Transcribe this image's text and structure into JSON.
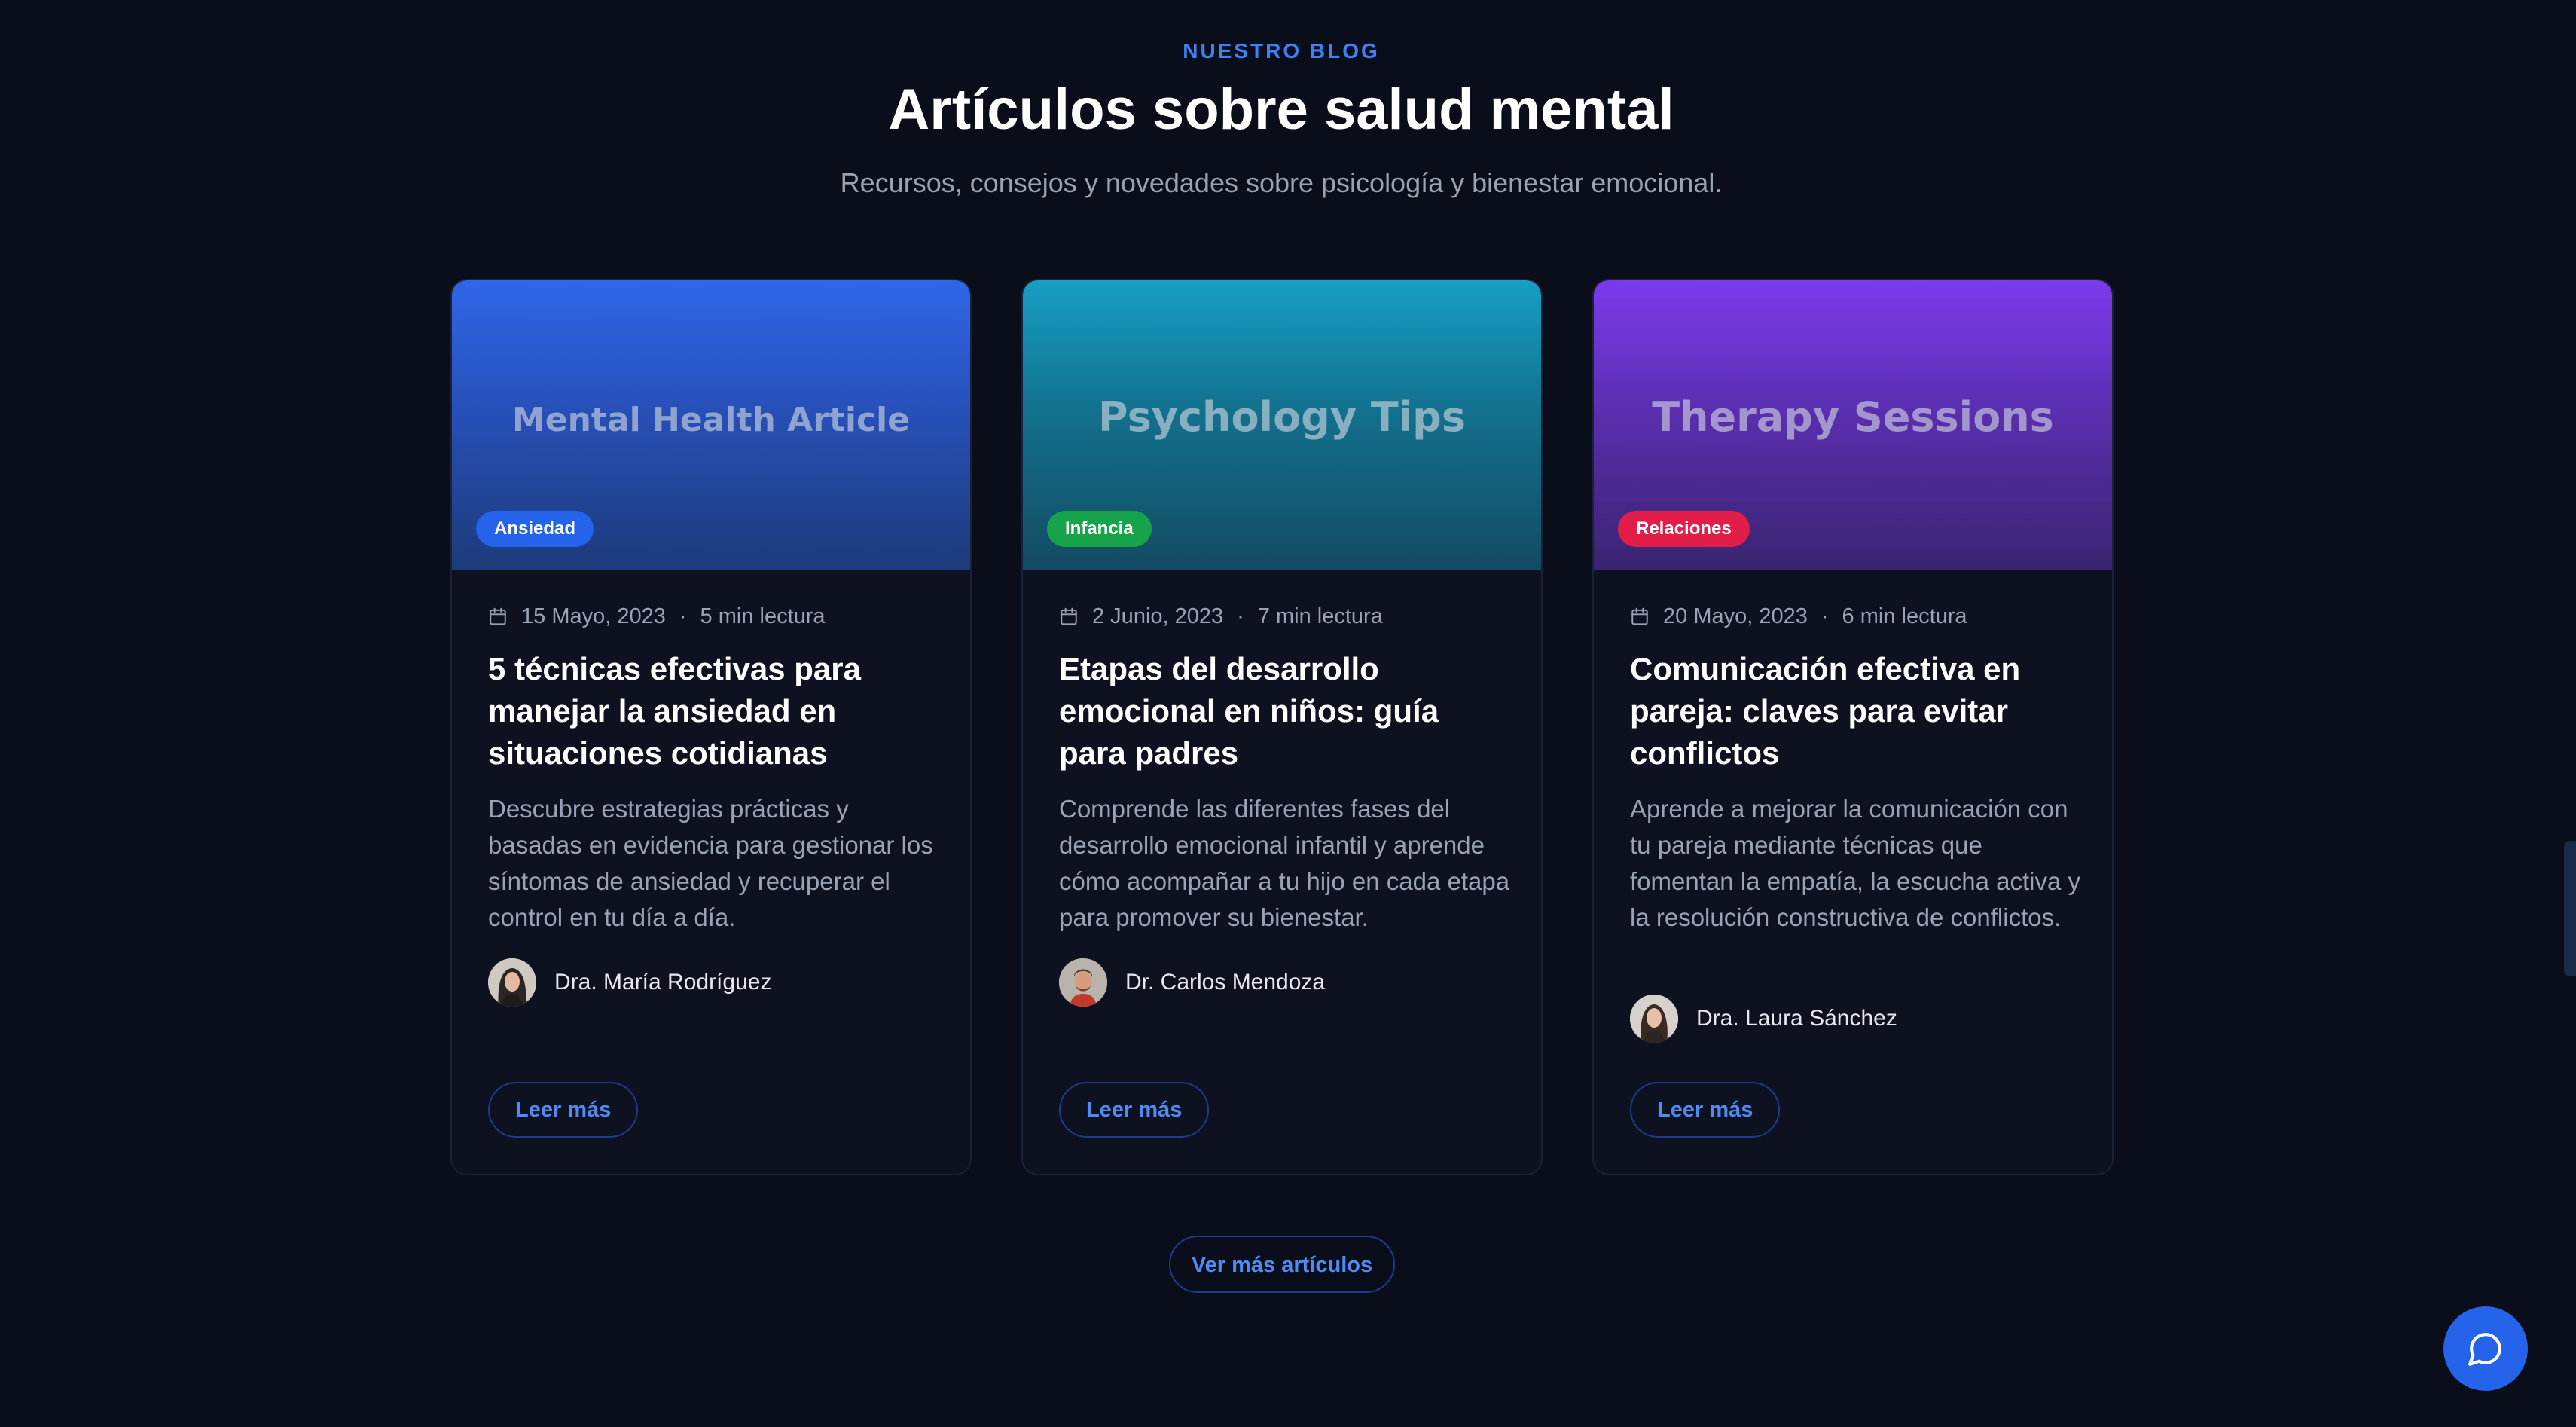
{
  "header": {
    "eyebrow": "NUESTRO BLOG",
    "title": "Artículos sobre salud mental",
    "subtitle": "Recursos, consejos y novedades sobre psicología y bienestar emocional."
  },
  "articles": [
    {
      "hero_text": "Mental Health Article",
      "badge": "Ansiedad",
      "date": "15 Mayo, 2023",
      "separator": "·",
      "read_time": "5 min lectura",
      "title": "5 técnicas efectivas para manejar la ansiedad en situaciones cotidianas",
      "excerpt": "Descubre estrategias prácticas y basadas en evidencia para gestionar los síntomas de ansiedad y recuperar el control en tu día a día.",
      "author": "Dra. María Rodríguez",
      "cta": "Leer más"
    },
    {
      "hero_text": "Psychology Tips",
      "badge": "Infancia",
      "date": "2 Junio, 2023",
      "separator": "·",
      "read_time": "7 min lectura",
      "title": "Etapas del desarrollo emocional en niños: guía para padres",
      "excerpt": "Comprende las diferentes fases del desarrollo emocional infantil y aprende cómo acompañar a tu hijo en cada etapa para promover su bienestar.",
      "author": "Dr. Carlos Mendoza",
      "cta": "Leer más"
    },
    {
      "hero_text": "Therapy Sessions",
      "badge": "Relaciones",
      "date": "20 Mayo, 2023",
      "separator": "·",
      "read_time": "6 min lectura",
      "title": "Comunicación efectiva en pareja: claves para evitar conflictos",
      "excerpt": "Aprende a mejorar la comunicación con tu pareja mediante técnicas que fomentan la empatía, la escucha activa y la resolución constructiva de conflictos.",
      "author": "Dra. Laura Sánchez",
      "cta": "Leer más"
    }
  ],
  "more_button": "Ver más artículos",
  "icons": {
    "calendar": "calendar-icon",
    "chat": "chat-bubble-icon"
  },
  "colors": {
    "background": "#0a0d1a",
    "accent": "#3b82f6",
    "badge_ansiedad": "#2563eb",
    "badge_infancia": "#16a34a",
    "badge_relaciones": "#e11d48"
  }
}
